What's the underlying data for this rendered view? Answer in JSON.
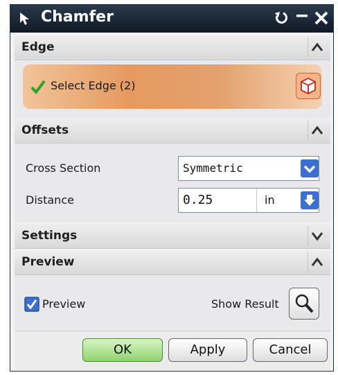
{
  "window": {
    "title": "Chamfer"
  },
  "sections": {
    "edge": {
      "title": "Edge",
      "select_label": "Select Edge (2)"
    },
    "offsets": {
      "title": "Offsets",
      "cross_section_label": "Cross Section",
      "cross_section_value": "Symmetric",
      "distance_label": "Distance",
      "distance_value": "0.25",
      "distance_unit": "in"
    },
    "settings": {
      "title": "Settings"
    },
    "preview": {
      "title": "Preview",
      "preview_checkbox_label": "Preview",
      "preview_checked": true,
      "show_result_label": "Show Result"
    }
  },
  "buttons": {
    "ok": "OK",
    "apply": "Apply",
    "cancel": "Cancel"
  },
  "colors": {
    "titlebar": "#172331",
    "select_bar": "#e69a60",
    "ok_button": "#8fd36f",
    "dropdown_arrow": "#3b6fd0",
    "check": "#2aa52a"
  },
  "icons": {
    "titlebar": "select-arrow-icon",
    "reset": "reset-icon",
    "minimize": "minimize-icon",
    "close": "close-icon",
    "edge_select": "cube-icon",
    "show_result": "magnifier-icon"
  }
}
